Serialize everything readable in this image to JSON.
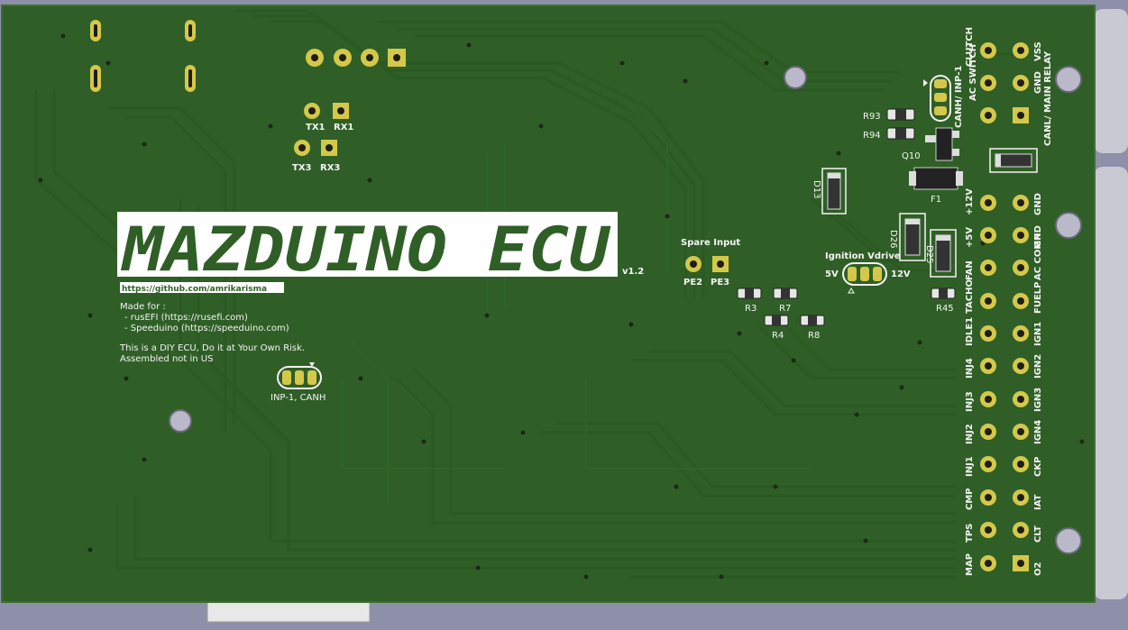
{
  "board": {
    "title": "MAZDUINO ECU",
    "version": "v1.2",
    "url": "https://github.com/amrikarisma",
    "made_for": "Made for :",
    "made_for_items": [
      "- rusEFI (https://rusefi.com)",
      "- Speeduino (https://speeduino.com)"
    ],
    "disclaimer_1": "This is a DIY ECU, Do it at Your Own Risk.",
    "disclaimer_2": "Assembled not in US"
  },
  "labels": {
    "tx1": "TX1",
    "rx1": "RX1",
    "tx3": "TX3",
    "rx3": "RX3",
    "spare_input": "Spare Input",
    "pe2": "PE2",
    "pe3": "PE3",
    "inp_canh": "INP-1, CANH",
    "ignition_vdrive": "Ignition Vdrive",
    "v5": "5V",
    "v12": "12V",
    "r3": "R3",
    "r7": "R7",
    "r4": "R4",
    "r8": "R8",
    "r45": "R45",
    "r93": "R93",
    "r94": "R94",
    "q10": "Q10",
    "f1": "F1",
    "d13": "D13",
    "d26": "D26",
    "d25": "D25",
    "canh_inp": "CANH/ INP-1",
    "ac_switch": "AC SWITCH",
    "canl_main": "CANL/ MAIN RELAY"
  },
  "connector_left": [
    "CLUTCH",
    "AC",
    "+12V",
    "+5V",
    "FAN",
    "TACHO",
    "IDLE1",
    "INJ4",
    "INJ3",
    "INJ2",
    "INJ1",
    "CMP",
    "TPS",
    "MAP"
  ],
  "connector_right": [
    "VSS",
    "GND",
    "GND",
    "GND",
    "AC COMP",
    "FUELP",
    "IGN1",
    "IGN2",
    "IGN3",
    "IGN4",
    "CKP",
    "IAT",
    "CLT",
    "O2"
  ]
}
